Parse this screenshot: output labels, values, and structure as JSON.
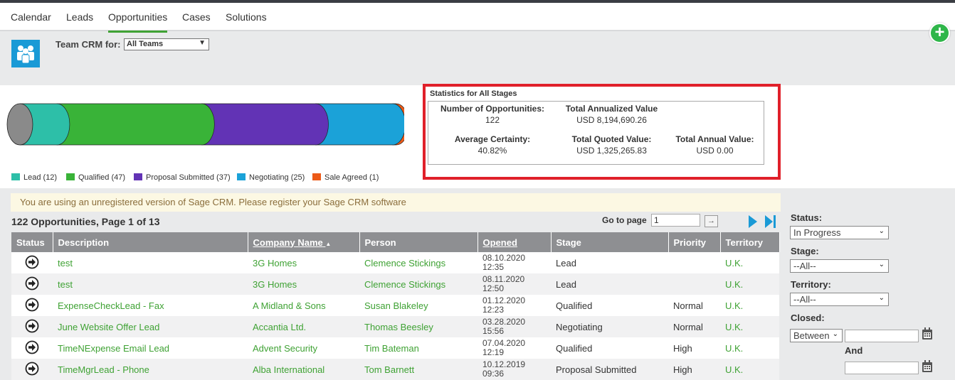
{
  "nav": {
    "tabs": [
      {
        "label": "Calendar"
      },
      {
        "label": "Leads"
      },
      {
        "label": "Opportunities"
      },
      {
        "label": "Cases"
      },
      {
        "label": "Solutions"
      }
    ],
    "active_tab": "Opportunities",
    "new_button_icon": "plus-icon"
  },
  "team": {
    "label": "Team CRM for:",
    "selected": "All Teams",
    "icon": "team-icon"
  },
  "pipeline": {
    "stages": [
      {
        "label": "Lead (12)",
        "count": 12,
        "color": "#2dbfa8"
      },
      {
        "label": "Qualified (47)",
        "count": 47,
        "color": "#39b338"
      },
      {
        "label": "Proposal Submitted (37)",
        "count": 37,
        "color": "#6233b5"
      },
      {
        "label": "Negotiating (25)",
        "count": 25,
        "color": "#1ba2d8"
      },
      {
        "label": "Sale Agreed (1)",
        "count": 1,
        "color": "#ec5a18"
      }
    ]
  },
  "stats": {
    "title": "Statistics for All Stages",
    "num_opps_label": "Number of Opportunities:",
    "num_opps_value": "122",
    "total_annualized_label": "Total Annualized Value",
    "total_annualized_value": "USD 8,194,690.26",
    "avg_certainty_label": "Average Certainty:",
    "avg_certainty_value": "40.82%",
    "total_quoted_label": "Total Quoted Value:",
    "total_quoted_value": "USD 1,325,265.83",
    "total_annual_label": "Total Annual Value:",
    "total_annual_value": "USD 0.00"
  },
  "banner": "You are using an unregistered version of Sage CRM. Please register your Sage CRM software",
  "list": {
    "title": "122 Opportunities, Page 1 of 13",
    "goto_label": "Go to page",
    "goto_value": "1",
    "goto_button": "→"
  },
  "table": {
    "headers": {
      "status": "Status",
      "description": "Description",
      "company": "Company Name",
      "company_sort": "▲",
      "person": "Person",
      "opened": "Opened",
      "stage": "Stage",
      "priority": "Priority",
      "territory": "Territory"
    },
    "rows": [
      {
        "description": "test",
        "company": "3G Homes",
        "person": "Clemence Stickings",
        "opened_date": "08.10.2020",
        "opened_time": "12:35",
        "stage": "Lead",
        "priority": "",
        "territory": "U.K."
      },
      {
        "description": "test",
        "company": "3G Homes",
        "person": "Clemence Stickings",
        "opened_date": "08.11.2020",
        "opened_time": "12:50",
        "stage": "Lead",
        "priority": "",
        "territory": "U.K."
      },
      {
        "description": "ExpenseCheckLead - Fax",
        "company": "A Midland & Sons",
        "person": "Susan Blakeley",
        "opened_date": "01.12.2020",
        "opened_time": "12:23",
        "stage": "Qualified",
        "priority": "Normal",
        "territory": "U.K."
      },
      {
        "description": "June Website Offer Lead",
        "company": "Accantia Ltd.",
        "person": "Thomas Beesley",
        "opened_date": "03.28.2020",
        "opened_time": "15:56",
        "stage": "Negotiating",
        "priority": "Normal",
        "territory": "U.K."
      },
      {
        "description": "TimeNExpense Email Lead",
        "company": "Advent Security",
        "person": "Tim Bateman",
        "opened_date": "07.04.2020",
        "opened_time": "12:19",
        "stage": "Qualified",
        "priority": "High",
        "territory": "U.K."
      },
      {
        "description": "TimeMgrLead - Phone",
        "company": "Alba International",
        "person": "Tom Barnett",
        "opened_date": "10.12.2019",
        "opened_time": "09:36",
        "stage": "Proposal Submitted",
        "priority": "High",
        "territory": "U.K."
      }
    ]
  },
  "filters": {
    "status_label": "Status:",
    "status_value": "In Progress",
    "stage_label": "Stage:",
    "stage_value": "--All--",
    "territory_label": "Territory:",
    "territory_value": "--All--",
    "closed_label": "Closed:",
    "closed_mode": "Between",
    "and_label": "And",
    "closed_from": "",
    "closed_to": ""
  }
}
